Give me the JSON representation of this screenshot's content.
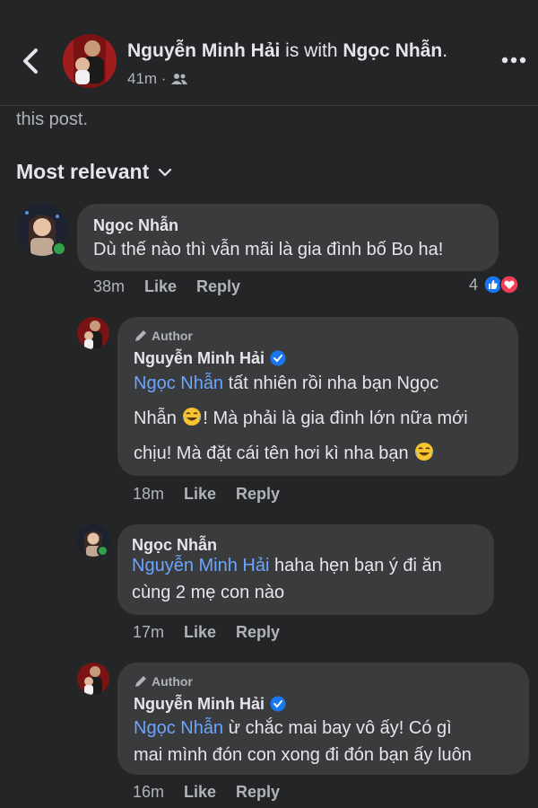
{
  "header": {
    "author_name": "Nguyễn Minh Hải",
    "with_text": " is with ",
    "tagged_name": "Ngọc Nhẫn",
    "tagged_suffix": ".",
    "time": "41m ·",
    "audience_icon": "friends-icon"
  },
  "prev_text": "this post.",
  "sort_label": "Most relevant",
  "comments": [
    {
      "name": "Ngọc Nhẫn",
      "text": "Dù thế nào thì vẫn mãi là gia đình bố Bo ha!",
      "time": "38m",
      "like": "Like",
      "reply": "Reply",
      "reaction_count": "4"
    },
    {
      "badge": "Author",
      "name": "Nguyễn Minh Hải",
      "mention": "Ngọc Nhẫn",
      "line1": " tất nhiên rồi nha bạn Ngọc",
      "line2a": "Nhẫn ",
      "line2b": "! Mà phải là gia đình lớn nữa mới",
      "line3": "chịu! Mà đặt cái tên hơi kì nha bạn ",
      "time": "18m",
      "like": "Like",
      "reply": "Reply"
    },
    {
      "name": "Ngọc Nhẫn",
      "mention": "Nguyễn Minh Hải",
      "line1": " haha hẹn bạn ý đi ăn",
      "line2": "cùng 2 mẹ con nào",
      "time": "17m",
      "like": "Like",
      "reply": "Reply"
    },
    {
      "badge": "Author",
      "name": "Nguyễn Minh Hải",
      "mention": "Ngọc Nhẫn",
      "line1": " ừ chắc mai bay vô ấy! Có gì",
      "line2": "mai mình đón con xong đi đón bạn ấy luôn",
      "time": "16m",
      "like": "Like",
      "reply": "Reply"
    }
  ],
  "colors": {
    "background": "#242526",
    "bubble": "#3a3b3c",
    "mention": "#6aa6ff",
    "like_blue": "#1877f2",
    "love_red": "#f33e58"
  }
}
